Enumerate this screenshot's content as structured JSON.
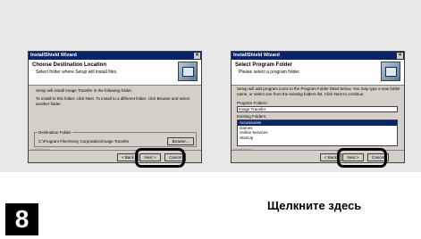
{
  "dialog1": {
    "window_title": "InstallShield Wizard",
    "close_glyph": "×",
    "header_title": "Choose Destination Location",
    "header_subtitle": "Select folder where Setup will install files.",
    "line1": "Setup will install Image Transfer in the following folder.",
    "line2": "To install to this folder, click Next. To install to a different folder, click Browse and select another folder.",
    "group_label": "Destination Folder",
    "path": "C:\\Program Files\\Sony Corporation\\Image Transfer",
    "browse_label": "Browse...",
    "brand": "InstallShield",
    "back_label": "< Back",
    "next_label": "Next >",
    "cancel_label": "Cancel"
  },
  "dialog2": {
    "window_title": "InstallShield Wizard",
    "close_glyph": "×",
    "header_title": "Select Program Folder",
    "header_subtitle": "Please select a program folder.",
    "line1": "Setup will add program icons to the Program Folder listed below. You may type a new folder name, or select one from the existing folders list. Click Next to continue.",
    "program_folders_label": "Program Folders:",
    "program_folder_value": "Image Transfer",
    "existing_folders_label": "Existing Folders:",
    "existing_folders": [
      "Accessories",
      "Games",
      "Online Services",
      "StartUp"
    ],
    "brand": "InstallShield",
    "back_label": "< Back",
    "next_label": "Next >",
    "cancel_label": "Cancel"
  },
  "step_number": "8",
  "caption": "Щелкните здесь"
}
